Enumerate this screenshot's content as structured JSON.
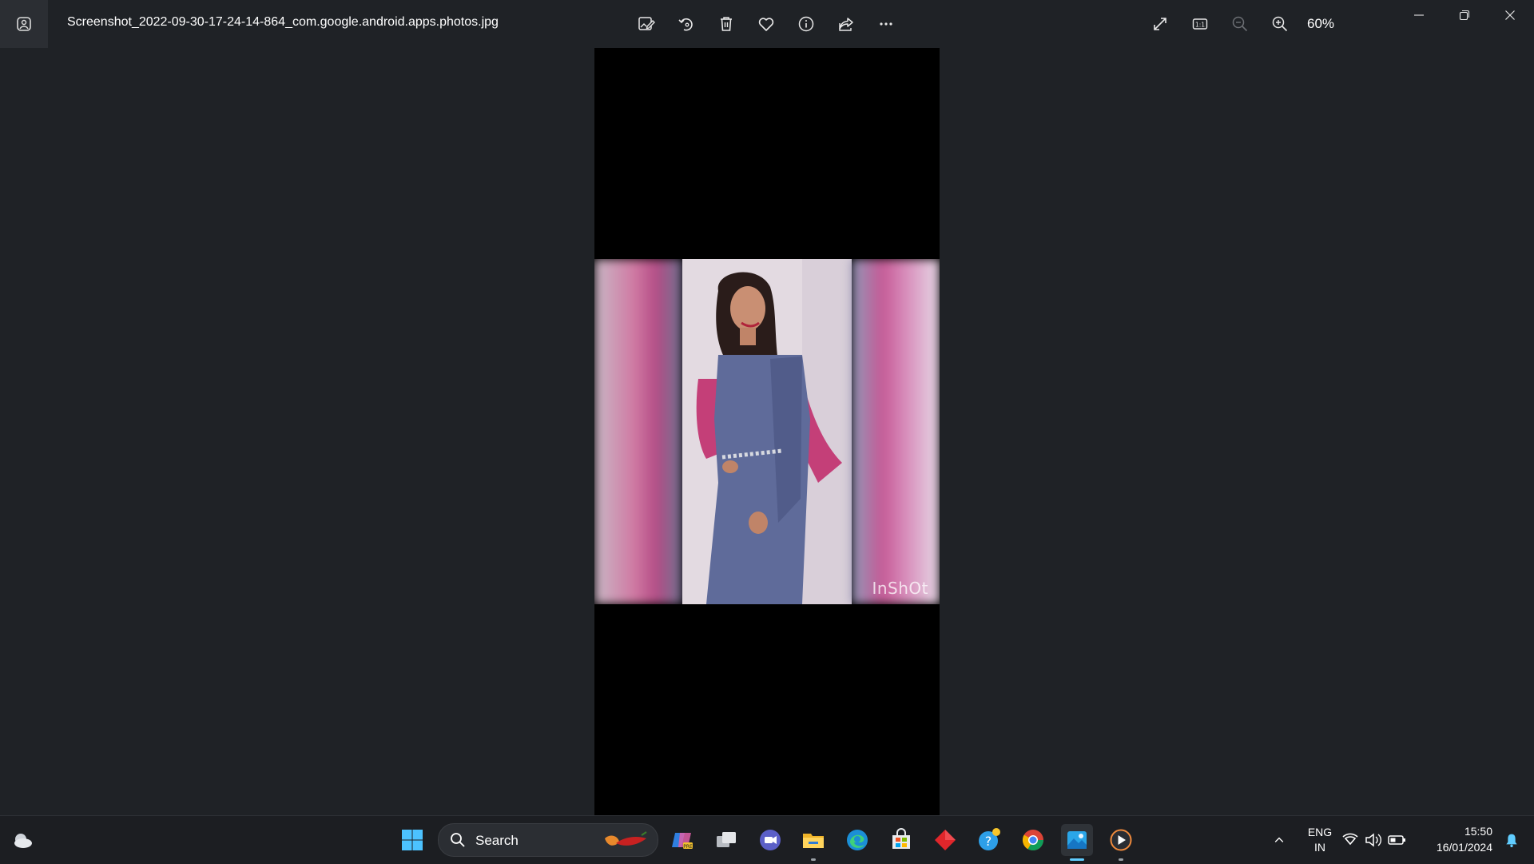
{
  "window": {
    "file_name": "Screenshot_2022-09-30-17-24-14-864_com.google.android.apps.photos.jpg",
    "zoom_level": "60%"
  },
  "toolbar": {
    "icons": [
      "edit-image-icon",
      "rotate-icon",
      "delete-icon",
      "favorite-icon",
      "info-icon",
      "share-icon",
      "more-icon"
    ],
    "right_icons": [
      "full-screen-icon",
      "actual-size-icon",
      "zoom-out-icon",
      "zoom-in-icon"
    ]
  },
  "photo": {
    "watermark": "InShOt"
  },
  "taskbar": {
    "search_label": "Search",
    "apps": [
      "start",
      "search",
      "copilot",
      "task-view",
      "teams",
      "file-explorer",
      "edge",
      "store",
      "app-red",
      "help",
      "chrome",
      "photos",
      "media-player"
    ],
    "language_line1": "ENG",
    "language_line2": "IN",
    "time": "15:50",
    "date": "16/01/2024"
  },
  "colors": {
    "background": "#1f2226",
    "accent": "#60cdff"
  }
}
